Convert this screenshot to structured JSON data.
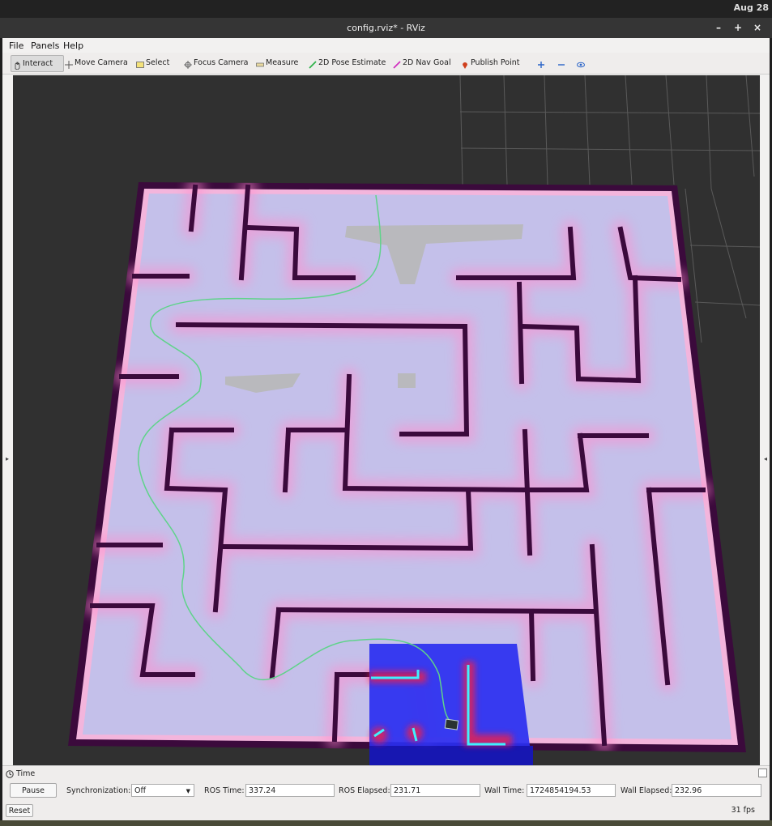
{
  "system": {
    "date": "Aug 28"
  },
  "window": {
    "title": "config.rviz* - RViz",
    "minimize": "–",
    "maximize": "+",
    "close": "×"
  },
  "menu": [
    "File",
    "Panels",
    "Help"
  ],
  "toolbar": {
    "interact": "Interact",
    "move_camera": "Move Camera",
    "select": "Select",
    "focus_camera": "Focus Camera",
    "measure": "Measure",
    "pose_estimate": "2D Pose Estimate",
    "nav_goal": "2D Nav Goal",
    "publish_point": "Publish Point"
  },
  "time_panel": {
    "title": "Time",
    "pause_label": "Pause",
    "sync_label": "Synchronization:",
    "sync_value": "Off",
    "ros_time_label": "ROS Time:",
    "ros_time": "337.24",
    "ros_elapsed_label": "ROS Elapsed:",
    "ros_elapsed": "231.71",
    "wall_time_label": "Wall Time:",
    "wall_time": "1724854194.53",
    "wall_elapsed_label": "Wall Elapsed:",
    "wall_elapsed": "232.96",
    "reset_label": "Reset",
    "fps": "31 fps"
  },
  "colors": {
    "map_free": "#c4c0ea",
    "map_wall": "#3b0a3c",
    "inflation": "#ff9fd6",
    "costmap": "#2a2ff0",
    "path": "#5fd38a",
    "viewport_bg": "#303030"
  }
}
